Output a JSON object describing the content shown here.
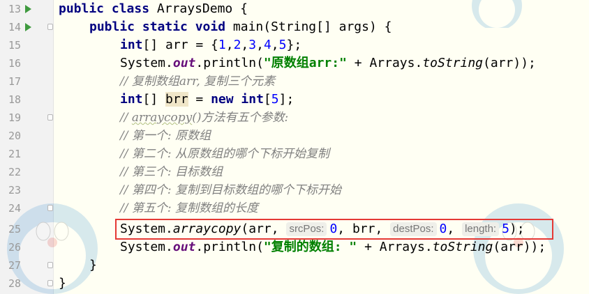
{
  "editor": {
    "lines": [
      {
        "n": "13",
        "parts": [
          "public class ArraysDemo {"
        ]
      },
      {
        "n": "14",
        "parts": [
          "public static void main(String[] args) {"
        ]
      },
      {
        "n": "15",
        "parts": [
          "int[] arr = {1,2,3,4,5};"
        ]
      },
      {
        "n": "16",
        "parts": [
          "System.out.println(\"原数组arr:\" + Arrays.toString(arr));"
        ]
      },
      {
        "n": "17",
        "parts": [
          "// 复制数组arr, 复制三个元素"
        ]
      },
      {
        "n": "18",
        "parts": [
          "int[] brr = new int[5];"
        ]
      },
      {
        "n": "19",
        "parts": [
          "// arraycopy()方法有五个参数:"
        ]
      },
      {
        "n": "20",
        "parts": [
          "// 第一个: 原数组"
        ]
      },
      {
        "n": "21",
        "parts": [
          "// 第二个: 从原数组的哪个下标开始复制"
        ]
      },
      {
        "n": "22",
        "parts": [
          "// 第三个: 目标数组"
        ]
      },
      {
        "n": "23",
        "parts": [
          "// 第四个: 复制到目标数组的哪个下标开始"
        ]
      },
      {
        "n": "24",
        "parts": [
          "// 第五个: 复制数组的长度"
        ]
      },
      {
        "n": "25",
        "parts": [
          "System.arraycopy(arr, srcPos: 0, brr, destPos: 0, length: 5);"
        ]
      },
      {
        "n": "26",
        "parts": [
          "System.out.println(\"复制的数组: \" + Arrays.toString(arr));"
        ]
      },
      {
        "n": "27",
        "parts": [
          "}"
        ]
      },
      {
        "n": "28",
        "parts": [
          "}"
        ]
      }
    ],
    "tokens": {
      "l13": {
        "a": "public class ",
        "b": "ArraysDemo {"
      },
      "l14": {
        "a": "public static void ",
        "b": "main(String[] args) {"
      },
      "l15": {
        "a": "int",
        "b": "[] arr = {",
        "c": "1",
        "d": ",",
        "e": "2",
        "f": ",",
        "g": "3",
        "h": ",",
        "i": "4",
        "j": ",",
        "k": "5",
        "l": "};"
      },
      "l16": {
        "a": "System.",
        "b": "out",
        "c": ".println(",
        "d": "\"原数组arr:\"",
        "e": " + Arrays.",
        "f": "toString",
        "g": "(arr));"
      },
      "l17": {
        "a": "// 复制数组arr, 复制三个元素"
      },
      "l18": {
        "a": "int",
        "b": "[] ",
        "c": "brr",
        "d": " = ",
        "e": "new int",
        "f": "[",
        "g": "5",
        "h": "];"
      },
      "l19": {
        "a": "// ",
        "b": "arraycopy",
        "c": "()方法有五个参数:"
      },
      "l20": {
        "a": "// 第一个: 原数组"
      },
      "l21": {
        "a": "// 第二个: 从原数组的哪个下标开始复制"
      },
      "l22": {
        "a": "// 第三个: 目标数组"
      },
      "l23": {
        "a": "// 第四个: 复制到目标数组的哪个下标开始"
      },
      "l24": {
        "a": "// 第五个: 复制数组的长度"
      },
      "l25": {
        "a": "System.",
        "b": "arraycopy",
        "c": "(arr, ",
        "h1": "srcPos:",
        "d": "0",
        ", brr": ", brr, ",
        "h2": "destPos:",
        "e": "0",
        "f": ", ",
        "h3": "length:",
        "g": "5",
        "end": ");"
      },
      "l26": {
        "a": "System.",
        "b": "out",
        "c": ".println(",
        "d": "\"复制的数组: \"",
        "e": " + Arrays.",
        "f": "toString",
        "g": "(arr));"
      },
      "l27": {
        "a": "}"
      },
      "l28": {
        "a": "}"
      }
    },
    "colors": {
      "keyword": "#000080",
      "number": "#0000ff",
      "string": "#008000",
      "comment": "#808080",
      "highlight_box": "#e53935"
    }
  }
}
